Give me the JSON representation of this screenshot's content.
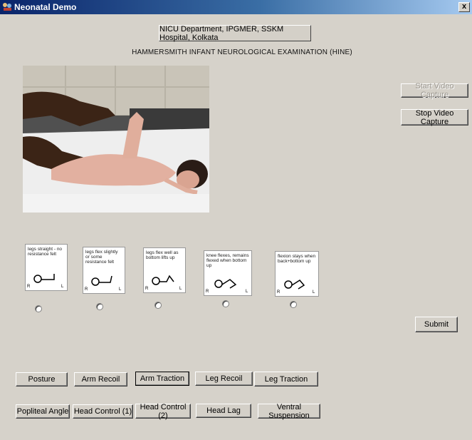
{
  "window": {
    "title": "Neonatal Demo",
    "close_glyph": "x"
  },
  "header": {
    "department": "NICU Department, IPGMER, SSKM Hospital, Kolkata",
    "exam_title": "HAMMERSMITH INFANT NEUROLOGICAL EXAMINATION (HINE)"
  },
  "video": {
    "start_label": "Start Video Capture",
    "stop_label": "Stop Video Capture"
  },
  "options": [
    {
      "text": "legs straight - no resistance felt"
    },
    {
      "text": "legs flex slightly or some resistance felt"
    },
    {
      "text": "legs flex well as bottom lifts up"
    },
    {
      "text": "knee flexes, remains flexed when bottom up"
    },
    {
      "text": "flexion stays when back+bottom up"
    }
  ],
  "card_labels": {
    "right": "R",
    "left": "L"
  },
  "submit_label": "Submit",
  "tests": {
    "row1": [
      "Posture",
      "Arm Recoil",
      "Arm Traction",
      "Leg Recoil",
      "Leg Traction"
    ],
    "row2": [
      "Popliteal Angle",
      "Head Control (1)",
      "Head Control (2)",
      "Head Lag",
      "Ventral Suspension"
    ]
  },
  "colors": {
    "titlebar_start": "#0a246a",
    "background": "#d6d2ca"
  }
}
